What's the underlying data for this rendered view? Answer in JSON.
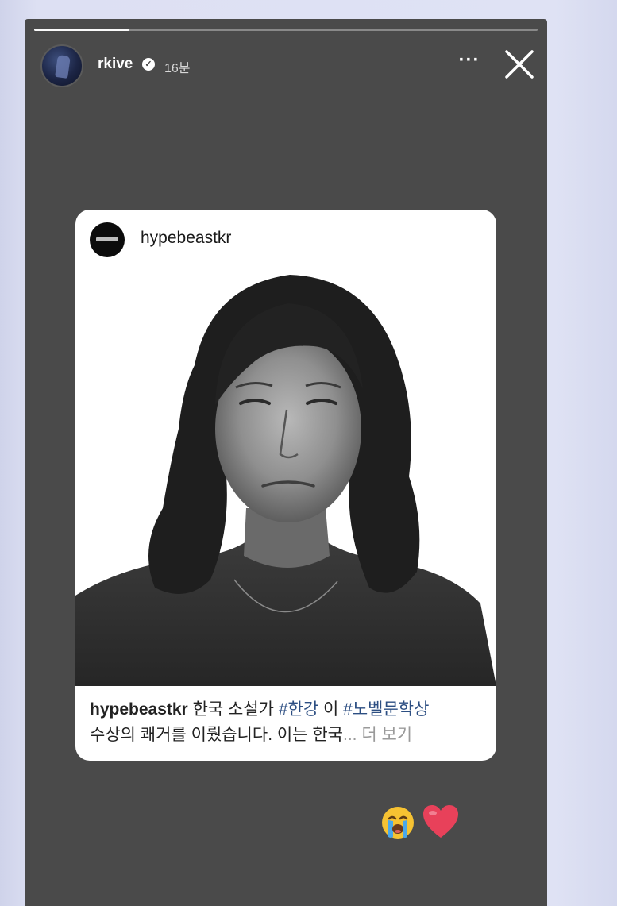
{
  "story": {
    "progress": 0.19,
    "username": "rkive",
    "verified_icon": "verified-badge-icon",
    "time": "16분",
    "more_icon": "more-horizontal-icon",
    "more_glyph": "···",
    "close_icon": "close-icon"
  },
  "shared_post": {
    "username": "hypebeastkr",
    "caption_user": "hypebeastkr",
    "caption_text_1": " 한국 소설가 ",
    "caption_tag_1": "#한강",
    "caption_text_2": " 이 ",
    "caption_tag_2": "#노벨문학상",
    "caption_line_2": "수상의 쾌거를 이뤘습니다. 이는 한국",
    "caption_more": "... 더 보기"
  },
  "stickers": {
    "emoji_1": "loudly-crying-face-icon",
    "emoji_2": "red-heart-icon"
  },
  "colors": {
    "story_bg": "#4a4a4a",
    "hashtag": "#2c4e82",
    "heart": "#e8415a"
  }
}
